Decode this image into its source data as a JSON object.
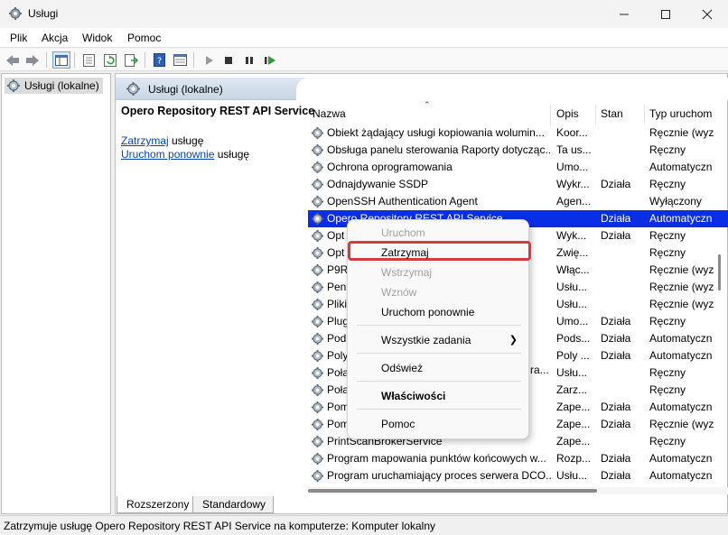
{
  "window": {
    "title": "Usługi",
    "minimize_icon": "minimize-icon",
    "maximize_icon": "maximize-icon",
    "close_icon": "close-icon"
  },
  "menu": [
    "Plik",
    "Akcja",
    "Widok",
    "Pomoc"
  ],
  "tree": {
    "root_label": "Usługi (lokalne)"
  },
  "pane_header": "Usługi (lokalne)",
  "description": {
    "service_title": "Opero Repository REST API Service",
    "stop_link": "Zatrzymaj",
    "stop_suffix": " usługę",
    "restart_link": "Uruchom ponownie",
    "restart_suffix": " usługę"
  },
  "columns": [
    "Nazwa",
    "Opis",
    "Stan",
    "Typ uruchom"
  ],
  "rows": [
    {
      "name": "Obiekt żądający usługi kopiowania wolumin...",
      "desc": "Koor...",
      "state": "",
      "type": "Ręcznie (wyz"
    },
    {
      "name": "Obsługa panelu sterowania Raporty dotycząc...",
      "desc": "Ta us...",
      "state": "",
      "type": "Ręczny"
    },
    {
      "name": "Ochrona oprogramowania",
      "desc": "Umo...",
      "state": "",
      "type": "Automatyczn"
    },
    {
      "name": "Odnajdywanie SSDP",
      "desc": "Wykr...",
      "state": "Działa",
      "type": "Ręczny"
    },
    {
      "name": "OpenSSH Authentication Agent",
      "desc": "Agen...",
      "state": "",
      "type": "Wyłączony"
    },
    {
      "name": "Opero Repository REST API Service",
      "desc": "",
      "state": "Działa",
      "type": "Automatyczn",
      "selected": true
    },
    {
      "name": "Opt",
      "desc": "Wyk...",
      "state": "Działa",
      "type": "Ręczny"
    },
    {
      "name": "Opt",
      "desc": "Zwię...",
      "state": "",
      "type": "Ręczny"
    },
    {
      "name": "P9R",
      "desc": "Włąc...",
      "state": "",
      "type": "Ręcznie (wyz"
    },
    {
      "name": "Pen",
      "desc": "Usłu...",
      "state": "",
      "type": "Ręcznie (wyz"
    },
    {
      "name": "Pliki",
      "desc": "Usłu...",
      "state": "",
      "type": "Ręcznie (wyz"
    },
    {
      "name": "Plug",
      "desc": "Umo...",
      "state": "Działa",
      "type": "Ręczny"
    },
    {
      "name": "Pod",
      "desc": "Pods...",
      "state": "Działa",
      "type": "Automatyczn"
    },
    {
      "name": "Poly",
      "desc": "Poly ...",
      "state": "Działa",
      "type": "Automatyczn"
    },
    {
      "name": "Połą",
      "desc": "Usłu...",
      "state": "",
      "type": "Ręczny"
    },
    {
      "name": "Połą",
      "desc": "Zarz...",
      "state": "",
      "type": "Ręczny"
    },
    {
      "name": "Pom",
      "desc": "Zape...",
      "state": "Działa",
      "type": "Automatyczn"
    },
    {
      "name": "Pom",
      "desc": "Zape...",
      "state": "Działa",
      "type": "Ręcznie (wyz"
    },
    {
      "name": "PrintScanBrokerService",
      "desc": "Zape...",
      "state": "",
      "type": "Ręczny"
    },
    {
      "name": "Program mapowania punktów końcowych w...",
      "desc": "Rozp...",
      "state": "Działa",
      "type": "Automatyczn"
    },
    {
      "name": "Program uruchamiający proces serwera DCO...",
      "desc": "Usłu...",
      "state": "Działa",
      "type": "Automatyczn"
    }
  ],
  "context_menu": {
    "start": "Uruchom",
    "stop": "Zatrzymaj",
    "pause": "Wstrzymaj",
    "resume": "Wznów",
    "restart": "Uruchom ponownie",
    "all_tasks": "Wszystkie zadania",
    "refresh": "Odśwież",
    "properties": "Właściwości",
    "help": "Pomoc",
    "clipped_name_suffix": "ra..."
  },
  "tabs": [
    "Rozszerzony",
    "Standardowy"
  ],
  "status": "Zatrzymuje usługę Opero Repository REST API Service na komputerze: Komputer lokalny",
  "colors": {
    "selection": "#0a2ee6",
    "highlight_box": "#d93a3a",
    "link": "#0645ad"
  }
}
